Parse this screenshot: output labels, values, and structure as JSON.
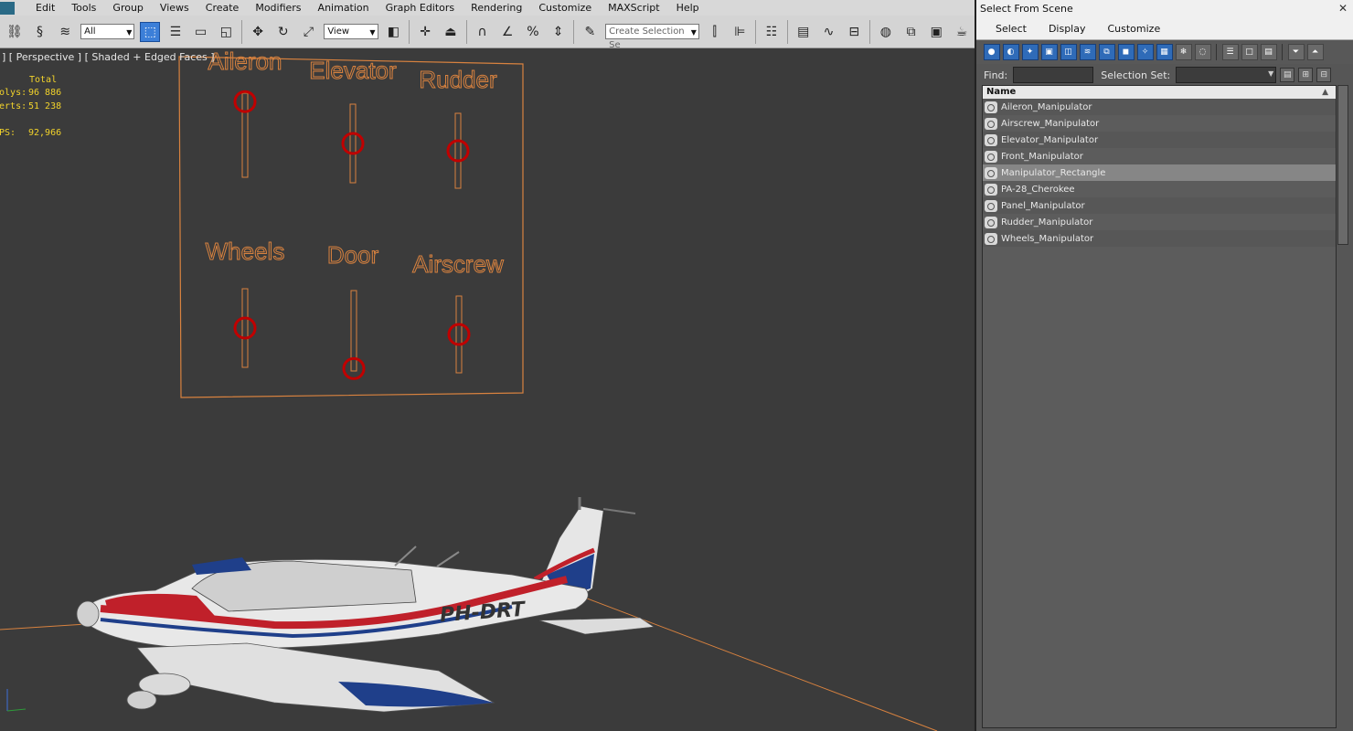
{
  "menubar": {
    "items": [
      "Edit",
      "Tools",
      "Group",
      "Views",
      "Create",
      "Modifiers",
      "Animation",
      "Graph Editors",
      "Rendering",
      "Customize",
      "MAXScript",
      "Help"
    ]
  },
  "toolbar": {
    "filter_value": "All",
    "refcoord_value": "View",
    "selection_set_placeholder": "Create Selection Se"
  },
  "viewport": {
    "label": "] [ Perspective ] [ Shaded + Edged Faces ]",
    "stats": {
      "total_label": "Total",
      "polys_label": "Polys:",
      "polys_value": "96 886",
      "verts_label": "Verts:",
      "verts_value": "51 238",
      "fps_label": "FPS:",
      "fps_value": "92,966"
    },
    "panel_labels": [
      "Aileron",
      "Elevator",
      "Rudder",
      "Wheels",
      "Door",
      "Airscrew"
    ],
    "slider_levels": [
      0.1,
      0.5,
      0.5,
      0.5,
      0.97,
      0.5
    ],
    "registration": "PH-DRT",
    "colors": {
      "panel_line": "#d8823f",
      "handle": "#c00000",
      "axis": "#d8823f"
    }
  },
  "select_from_scene": {
    "title": "Select From Scene",
    "menu": [
      "Select",
      "Display",
      "Customize"
    ],
    "find_label": "Find:",
    "selection_set_label": "Selection Set:",
    "column_name": "Name",
    "items": [
      "Aileron_Manipulator",
      "Airscrew_Manipulator",
      "Elevator_Manipulator",
      "Front_Manipulator",
      "Manipulator_Rectangle",
      "PA-28_Cherokee",
      "Panel_Manipulator",
      "Rudder_Manipulator",
      "Wheels_Manipulator"
    ],
    "selected_index": 4
  }
}
